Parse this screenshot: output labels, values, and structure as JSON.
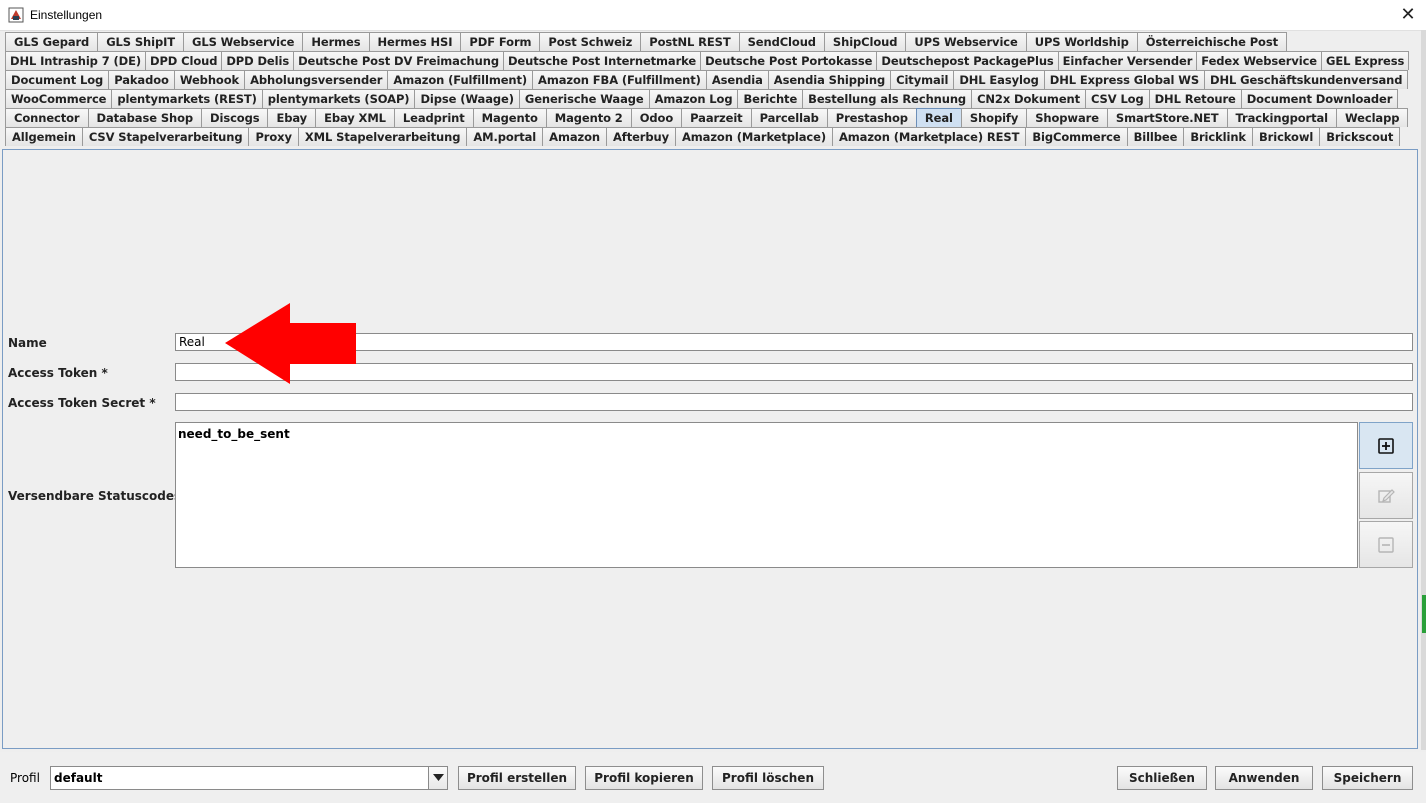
{
  "window": {
    "title": "Einstellungen"
  },
  "tabs": {
    "row1": [
      "GLS Gepard",
      "GLS ShipIT",
      "GLS Webservice",
      "Hermes",
      "Hermes HSI",
      "PDF Form",
      "Post Schweiz",
      "PostNL REST",
      "SendCloud",
      "ShipCloud",
      "UPS Webservice",
      "UPS Worldship",
      "Österreichische Post"
    ],
    "row2": [
      "DHL Intraship 7 (DE)",
      "DPD Cloud",
      "DPD Delis",
      "Deutsche Post DV Freimachung",
      "Deutsche Post Internetmarke",
      "Deutsche Post Portokasse",
      "Deutschepost PackagePlus",
      "Einfacher Versender",
      "Fedex Webservice",
      "GEL Express"
    ],
    "row3": [
      "Document Log",
      "Pakadoo",
      "Webhook",
      "Abholungsversender",
      "Amazon (Fulfillment)",
      "Amazon FBA (Fulfillment)",
      "Asendia",
      "Asendia Shipping",
      "Citymail",
      "DHL Easylog",
      "DHL Express Global WS",
      "DHL Geschäftskundenversand"
    ],
    "row4": [
      "WooCommerce",
      "plentymarkets (REST)",
      "plentymarkets (SOAP)",
      "Dipse (Waage)",
      "Generische Waage",
      "Amazon Log",
      "Berichte",
      "Bestellung als Rechnung",
      "CN2x Dokument",
      "CSV Log",
      "DHL Retoure",
      "Document Downloader"
    ],
    "row5": [
      "Connector",
      "Database Shop",
      "Discogs",
      "Ebay",
      "Ebay XML",
      "Leadprint",
      "Magento",
      "Magento 2",
      "Odoo",
      "Paarzeit",
      "Parcellab",
      "Prestashop",
      "Real",
      "Shopify",
      "Shopware",
      "SmartStore.NET",
      "Trackingportal",
      "Weclapp"
    ],
    "row6": [
      "Allgemein",
      "CSV Stapelverarbeitung",
      "Proxy",
      "XML Stapelverarbeitung",
      "AM.portal",
      "Amazon",
      "Afterbuy",
      "Amazon (Marketplace)",
      "Amazon (Marketplace) REST",
      "BigCommerce",
      "Billbee",
      "Bricklink",
      "Brickowl",
      "Brickscout"
    ],
    "selected": "Real"
  },
  "form": {
    "name_label": "Name",
    "name_value": "Real",
    "token_label": "Access Token *",
    "token_value": "",
    "secret_label": "Access Token Secret *",
    "secret_value": "",
    "status_label": "Versendbare Statuscodes *",
    "status_items": [
      "need_to_be_sent"
    ]
  },
  "bottom": {
    "profil_label": "Profil",
    "profil_value": "default",
    "create": "Profil erstellen",
    "copy": "Profil kopieren",
    "delete": "Profil löschen",
    "close": "Schließen",
    "apply": "Anwenden",
    "save": "Speichern"
  },
  "colors": {
    "arrow": "#ff0000",
    "selected_tab": "#cfe0f2",
    "panel_border": "#7a9cc4"
  },
  "icons": {
    "add": "plus-square-icon",
    "edit": "pencil-icon",
    "remove": "minus-square-icon"
  }
}
